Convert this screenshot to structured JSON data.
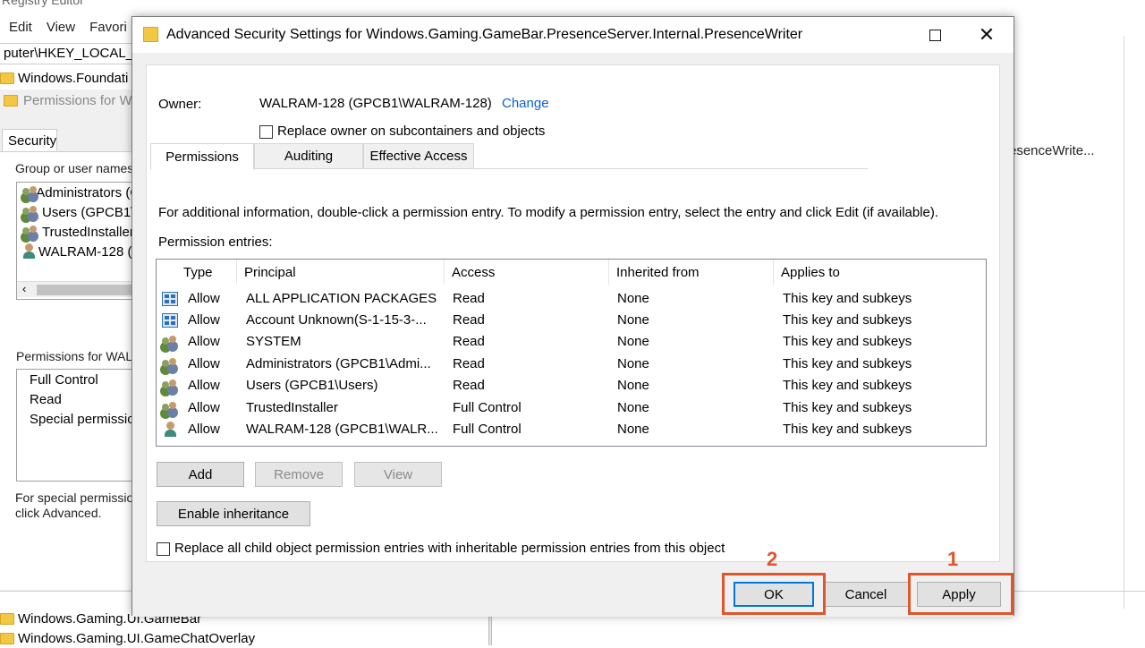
{
  "background": {
    "window_title": "Registry Editor",
    "menu": [
      "Edit",
      "View",
      "Favori"
    ],
    "address": "puter\\HKEY_LOCAL_M",
    "tree_top": "Windows.Foundati",
    "perm_window_title": "Permissions for W",
    "security_tab": "Security",
    "group_label": "Group or user names:",
    "groups": [
      "Administrators (G",
      "Users (GPCB1\\",
      "TrustedInstaller",
      "WALRAM-128 ("
    ],
    "permissions_for_label": "Permissions for WAL",
    "permission_rows": [
      "Full Control",
      "Read",
      "Special permission"
    ],
    "special_note_1": "For special permission",
    "special_note_2": "click Advanced.",
    "tree_bottom_1": "Windows.Gaming.UI.GameBar",
    "tree_bottom_2": "Windows.Gaming.UI.GameChatOverlay",
    "right_text": "esenceWrite..."
  },
  "dialog": {
    "title": "Advanced Security Settings for Windows.Gaming.GameBar.PresenceServer.Internal.PresenceWriter",
    "owner_label": "Owner:",
    "owner_value": "WALRAM-128 (GPCB1\\WALRAM-128)",
    "change_link": "Change",
    "replace_owner_label": "Replace owner on subcontainers and objects",
    "tabs": [
      "Permissions",
      "Auditing",
      "Effective Access"
    ],
    "info_text": "For additional information, double-click a permission entry. To modify a permission entry, select the entry and click Edit (if available).",
    "entries_label": "Permission entries:",
    "columns": [
      "Type",
      "Principal",
      "Access",
      "Inherited from",
      "Applies to"
    ],
    "entries": [
      {
        "icon": "package",
        "type": "Allow",
        "principal": "ALL APPLICATION PACKAGES",
        "access": "Read",
        "inherited": "None",
        "applies": "This key and subkeys"
      },
      {
        "icon": "package",
        "type": "Allow",
        "principal": "Account Unknown(S-1-15-3-...",
        "access": "Read",
        "inherited": "None",
        "applies": "This key and subkeys"
      },
      {
        "icon": "users",
        "type": "Allow",
        "principal": "SYSTEM",
        "access": "Read",
        "inherited": "None",
        "applies": "This key and subkeys"
      },
      {
        "icon": "users",
        "type": "Allow",
        "principal": "Administrators (GPCB1\\Admi...",
        "access": "Read",
        "inherited": "None",
        "applies": "This key and subkeys"
      },
      {
        "icon": "users",
        "type": "Allow",
        "principal": "Users (GPCB1\\Users)",
        "access": "Read",
        "inherited": "None",
        "applies": "This key and subkeys"
      },
      {
        "icon": "users",
        "type": "Allow",
        "principal": "TrustedInstaller",
        "access": "Full Control",
        "inherited": "None",
        "applies": "This key and subkeys"
      },
      {
        "icon": "user",
        "type": "Allow",
        "principal": "WALRAM-128 (GPCB1\\WALR...",
        "access": "Full Control",
        "inherited": "None",
        "applies": "This key and subkeys"
      }
    ],
    "add_label": "Add",
    "remove_label": "Remove",
    "view_label": "View",
    "enable_inheritance_label": "Enable inheritance",
    "replace_child_label": "Replace all child object permission entries with inheritable permission entries from this object",
    "ok_label": "OK",
    "cancel_label": "Cancel",
    "apply_label": "Apply"
  },
  "annotations": {
    "apply_number": "1",
    "ok_number": "2",
    "color": "#e0552b"
  }
}
